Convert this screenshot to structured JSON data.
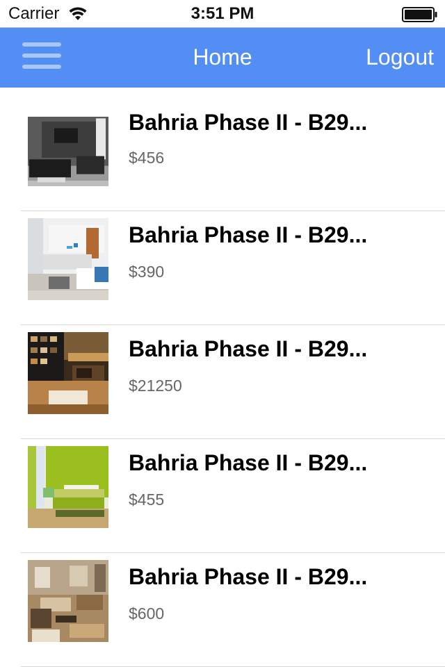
{
  "status_bar": {
    "carrier": "Carrier",
    "time": "3:51 PM",
    "wifi_icon": "wifi-icon",
    "battery_icon": "battery-icon"
  },
  "nav_bar": {
    "menu_icon": "hamburger-menu-icon",
    "title": "Home",
    "logout_label": "Logout",
    "background_color": "#528ef4"
  },
  "listings": [
    {
      "title": "Bahria Phase II - B29...",
      "price": "$456",
      "image": "living-room-photo"
    },
    {
      "title": "Bahria Phase II - B29...",
      "price": "$390",
      "image": "bedroom-kitchen-photo"
    },
    {
      "title": "Bahria Phase II - B29...",
      "price": "$21250",
      "image": "loft-stair-photo"
    },
    {
      "title": "Bahria Phase II - B29...",
      "price": "$455",
      "image": "green-bedroom-photo"
    },
    {
      "title": "Bahria Phase II - B29...",
      "price": "$600",
      "image": "lounge-dining-photo"
    }
  ]
}
